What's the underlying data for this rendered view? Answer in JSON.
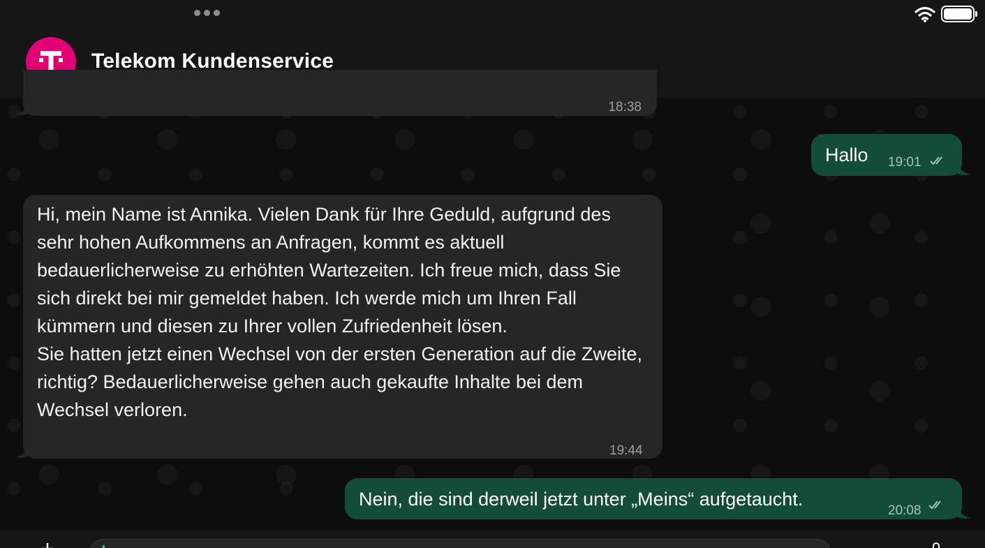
{
  "status_bar": {
    "wifi_icon": "wifi-icon",
    "battery_icon": "battery-icon"
  },
  "header": {
    "title": "Telekom Kundenservice",
    "avatar_letter": "T",
    "avatar_color": "#e20074"
  },
  "messages": [
    {
      "direction": "incoming",
      "text": "",
      "time": "18:38"
    },
    {
      "direction": "outgoing",
      "text": "Hallo",
      "time": "19:01",
      "status": "read"
    },
    {
      "direction": "incoming",
      "text": "Hi, mein Name ist Annika. Vielen Dank für Ihre Geduld, aufgrund des sehr hohen Aufkommens an Anfragen, kommt es aktuell bedauerlicherweise zu erhöhten Wartezeiten. Ich freue mich, dass Sie sich direkt bei mir gemeldet haben. Ich werde mich um Ihren Fall kümmern und diesen zu Ihrer vollen Zufriedenheit lösen.\nSie hatten jetzt einen Wechsel von der ersten Generation auf die Zweite, richtig? Bedauerlicherweise gehen auch gekaufte Inhalte bei dem Wechsel verloren.",
      "time": "19:44"
    },
    {
      "direction": "outgoing",
      "text": "Nein, die sind derweil jetzt unter „Meins“ aufgetaucht.",
      "time": "20:08",
      "status": "read"
    }
  ],
  "composer": {
    "value": "",
    "accent_color": "#25d366"
  },
  "colors": {
    "incoming_bubble": "#262626",
    "outgoing_bubble": "#144d37",
    "header_bg": "#161616"
  }
}
